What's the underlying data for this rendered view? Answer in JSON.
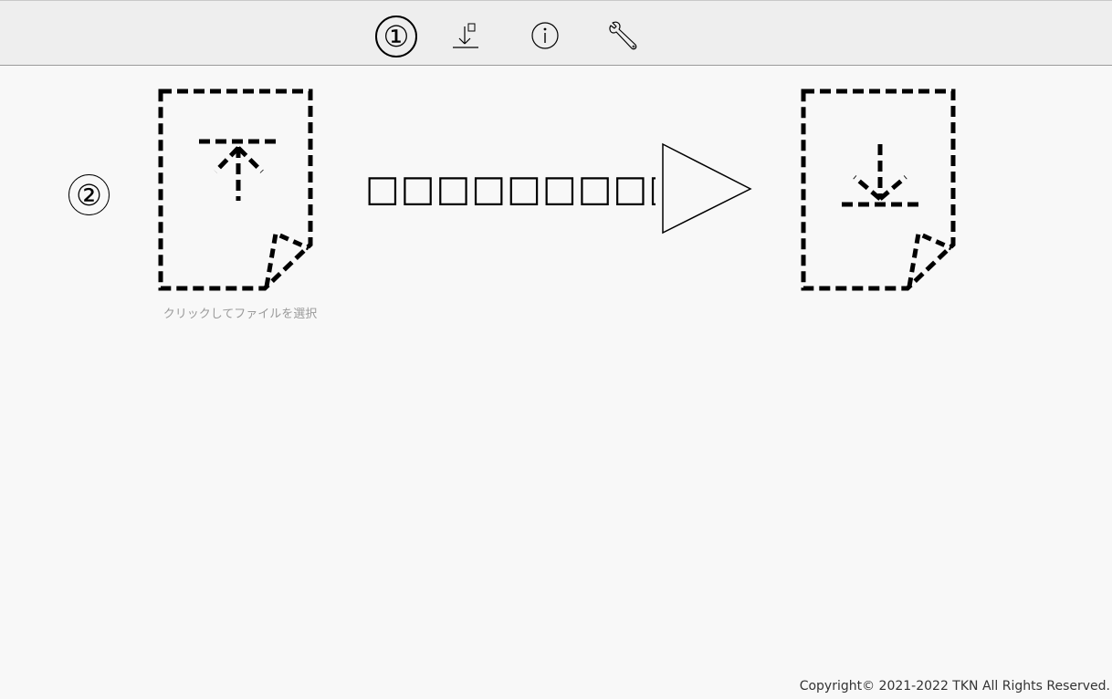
{
  "toolbar": {
    "step_marker": "①",
    "buttons": [
      {
        "name": "download-icon"
      },
      {
        "name": "info-icon"
      },
      {
        "name": "wrench-icon"
      }
    ]
  },
  "main": {
    "step_marker": "②",
    "input_file": {
      "icon": "file-upload-icon",
      "caption": "クリックしてファイルを選択"
    },
    "conversion_text": "□□□□□□□□□",
    "arrow_icon": "play-arrow-icon",
    "output_file": {
      "icon": "file-download-icon"
    }
  },
  "footer": {
    "copyright": "Copyright© 2021-2022 TKN All Rights Reserved."
  }
}
